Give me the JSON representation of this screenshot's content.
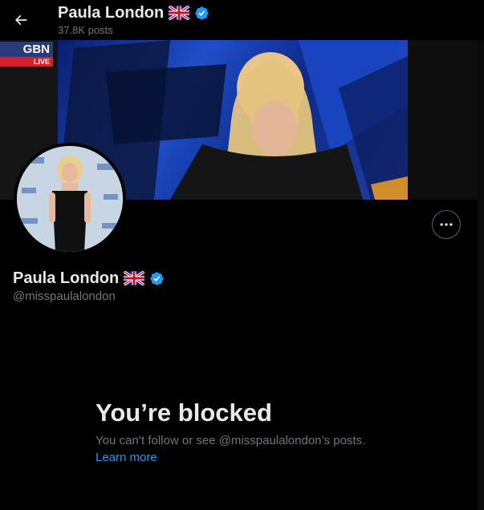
{
  "topbar": {
    "title": "Paula London",
    "posts_count": "37.8K posts"
  },
  "banner": {
    "logo_text": "GBN",
    "live_label": "LIVE"
  },
  "profile": {
    "name": "Paula London",
    "handle": "@misspaulalondon"
  },
  "blocked": {
    "title": "You’re blocked",
    "description": "You can’t follow or see @misspaulalondon’s posts.",
    "learn_more": "Learn more"
  },
  "colors": {
    "background": "#000000",
    "text_primary": "#e7e9ea",
    "text_secondary": "#71767b",
    "accent": "#1d9bf0"
  },
  "icons": {
    "back": "arrow-left-icon",
    "more": "more-dots-icon",
    "verified": "verified-badge-icon",
    "flag": "uk-flag-icon"
  }
}
